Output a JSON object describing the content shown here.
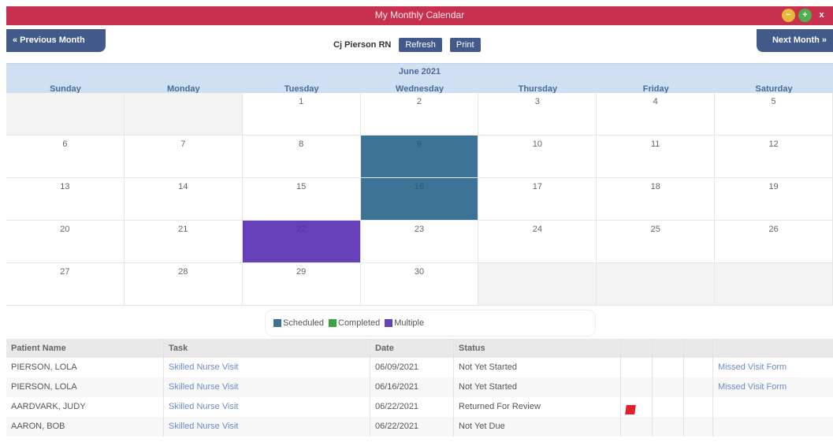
{
  "window": {
    "title": "My Monthly Calendar",
    "buttons": {
      "minimize": "−",
      "maximize": "+",
      "close": "x"
    }
  },
  "toolbar": {
    "prev_label": "« Previous Month",
    "next_label": "Next Month »",
    "user": "Cj Pierson RN",
    "refresh_label": "Refresh",
    "print_label": "Print"
  },
  "calendar": {
    "month": "June 2021",
    "weekdays": [
      "Sunday",
      "Monday",
      "Tuesday",
      "Wednesday",
      "Thursday",
      "Friday",
      "Saturday"
    ],
    "weeks": [
      [
        "",
        "",
        "1",
        "2",
        "3",
        "4",
        "5"
      ],
      [
        "6",
        "7",
        "8",
        "9",
        "10",
        "11",
        "12"
      ],
      [
        "13",
        "14",
        "15",
        "16",
        "17",
        "18",
        "19"
      ],
      [
        "20",
        "21",
        "22",
        "23",
        "24",
        "25",
        "26"
      ],
      [
        "27",
        "28",
        "29",
        "30",
        "",
        "",
        ""
      ]
    ],
    "highlights": {
      "9": "scheduled",
      "16": "scheduled",
      "22": "multiple"
    }
  },
  "legend": [
    {
      "label": "Scheduled",
      "color": "#3d7397"
    },
    {
      "label": "Completed",
      "color": "#3ea33e"
    },
    {
      "label": "Multiple",
      "color": "#6640b8"
    }
  ],
  "table": {
    "headers": [
      "Patient Name",
      "Task",
      "Date",
      "Status",
      "",
      "",
      "",
      ""
    ],
    "rows": [
      {
        "patient": "PIERSON, LOLA",
        "task": "Skilled Nurse Visit",
        "date": "06/09/2021",
        "status": "Not Yet Started",
        "flag": false,
        "extra": "Missed Visit Form"
      },
      {
        "patient": "PIERSON, LOLA",
        "task": "Skilled Nurse Visit",
        "date": "06/16/2021",
        "status": "Not Yet Started",
        "flag": false,
        "extra": "Missed Visit Form"
      },
      {
        "patient": "AARDVARK, JUDY",
        "task": "Skilled Nurse Visit",
        "date": "06/22/2021",
        "status": "Returned For Review",
        "flag": true,
        "extra": ""
      },
      {
        "patient": "AARON, BOB",
        "task": "Skilled Nurse Visit",
        "date": "06/22/2021",
        "status": "Not Yet Due",
        "flag": false,
        "extra": ""
      }
    ]
  }
}
